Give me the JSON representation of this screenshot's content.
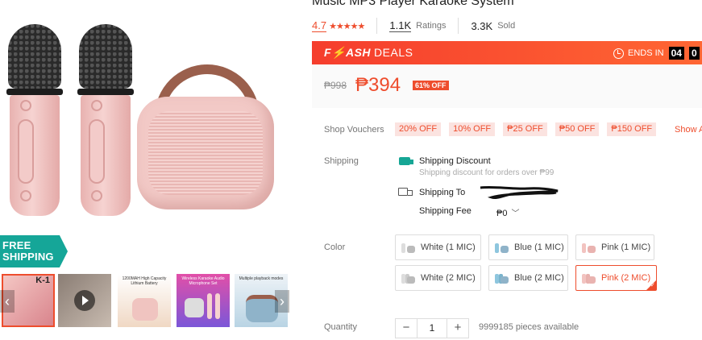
{
  "product": {
    "title": "Music MP3 Player Karaoke System",
    "rating": "4.7",
    "ratings_count": "1.1K",
    "ratings_label": "Ratings",
    "sold_count": "3.3K",
    "sold_label": "Sold"
  },
  "gallery": {
    "badge_line1": "FREE",
    "badge_line2": "SHIPPING",
    "thumbs": [
      {
        "caption": "K-1"
      },
      {
        "caption": ""
      },
      {
        "caption": "1200MAH High Capacity Lithium Battery"
      },
      {
        "caption": "Wireless Karaoke Audio Microphone Set"
      },
      {
        "caption": "Multiple playback modes"
      }
    ],
    "prev_icon": "chevron-left-icon",
    "next_icon": "chevron-right-icon"
  },
  "flash_deal": {
    "brand": "F⚡ASH",
    "deals": "DEALS",
    "ends_in": "ENDS IN",
    "hours": "04",
    "minutes": "0"
  },
  "price": {
    "original": "₱998",
    "current": "₱394",
    "discount": "61% OFF"
  },
  "vouchers": {
    "label": "Shop Vouchers",
    "items": [
      "20% OFF",
      "10% OFF",
      "₱25 OFF",
      "₱50 OFF",
      "₱150 OFF"
    ],
    "show_all": "Show A"
  },
  "shipping": {
    "label": "Shipping",
    "discount_title": "Shipping Discount",
    "discount_sub": "Shipping discount for orders over ₱99",
    "to_label": "Shipping To",
    "fee_label": "Shipping Fee",
    "fee_value": "₱0"
  },
  "color": {
    "label": "Color",
    "options": [
      {
        "label": "White (1 MIC)",
        "selected": false
      },
      {
        "label": "Blue (1 MIC)",
        "selected": false
      },
      {
        "label": "Pink (1 MIC)",
        "selected": false
      },
      {
        "label": "White (2 MIC)",
        "selected": false
      },
      {
        "label": "Blue (2 MIC)",
        "selected": false
      },
      {
        "label": "Pink (2 MIC)",
        "selected": true
      }
    ]
  },
  "quantity": {
    "label": "Quantity",
    "value": "1",
    "minus": "−",
    "plus": "+",
    "available": "9999185 pieces available"
  },
  "colors": {
    "accent": "#ee4d2d",
    "teal": "#16a695"
  }
}
